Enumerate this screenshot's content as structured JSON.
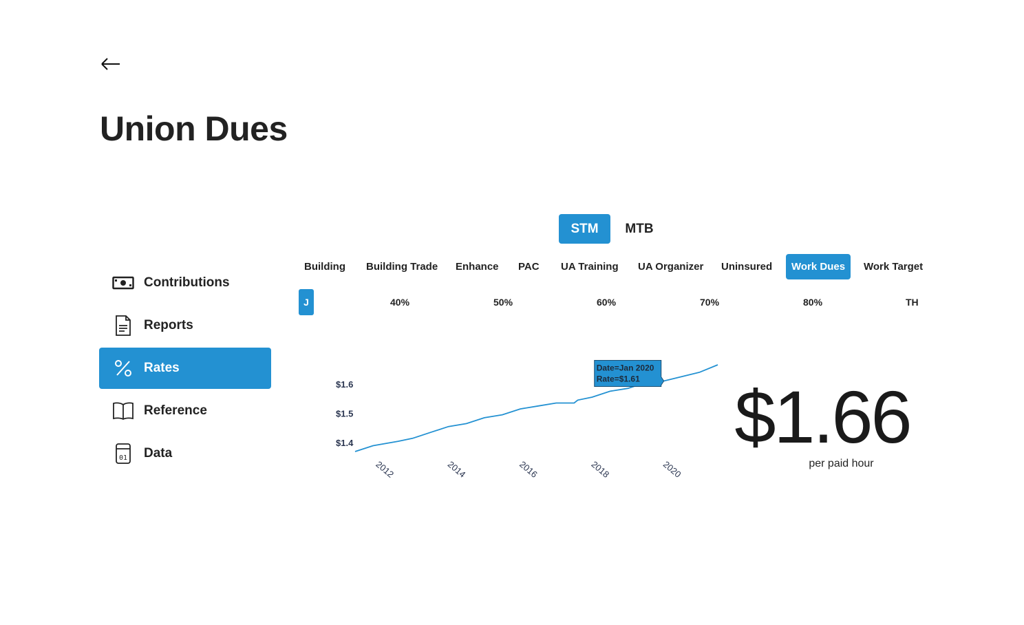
{
  "page": {
    "title": "Union Dues"
  },
  "nav": {
    "back_icon": "arrow-left-icon"
  },
  "sidebar": {
    "items": [
      {
        "label": "Contributions",
        "icon": "banknote-icon",
        "active": false
      },
      {
        "label": "Reports",
        "icon": "document-icon",
        "active": false
      },
      {
        "label": "Rates",
        "icon": "percent-icon",
        "active": true
      },
      {
        "label": "Reference",
        "icon": "book-icon",
        "active": false
      },
      {
        "label": "Data",
        "icon": "data-file-icon",
        "active": false
      }
    ]
  },
  "toggle": {
    "options": [
      "STM",
      "MTB"
    ],
    "selected": "STM"
  },
  "tabs": {
    "items": [
      "Building",
      "Building Trade",
      "Enhance",
      "PAC",
      "UA Training",
      "UA Organizer",
      "Uninsured",
      "Work Dues",
      "Work Target"
    ],
    "selected": "Work Dues"
  },
  "percent_row": {
    "items": [
      "J",
      "40%",
      "50%",
      "60%",
      "70%",
      "80%",
      "TH"
    ],
    "selected": "J"
  },
  "summary": {
    "rate": "$1.66",
    "unit": "per paid hour"
  },
  "colors": {
    "accent": "#2391d2",
    "line": "#2391d2"
  },
  "chart_data": {
    "type": "line",
    "x": [
      "2011.4",
      "2011.9",
      "2012.6",
      "2013.0",
      "2013.5",
      "2014.0",
      "2014.5",
      "2015.0",
      "2015.5",
      "2016.0",
      "2016.5",
      "2017.0",
      "2017.5",
      "2017.6",
      "2018.0",
      "2018.5",
      "2019.0",
      "2019.5",
      "2020.0",
      "2020.5",
      "2021.0",
      "2021.5"
    ],
    "values": [
      1.37,
      1.39,
      1.405,
      1.415,
      1.435,
      1.455,
      1.465,
      1.485,
      1.495,
      1.515,
      1.525,
      1.535,
      1.535,
      1.545,
      1.555,
      1.575,
      1.585,
      1.605,
      1.61,
      1.625,
      1.64,
      1.665
    ],
    "ylabels": [
      "$1.4",
      "$1.5",
      "$1.6"
    ],
    "yticks": [
      1.4,
      1.5,
      1.6
    ],
    "xlabels": [
      "2012",
      "2014",
      "2016",
      "2018",
      "2020"
    ],
    "xticks": [
      2012,
      2014,
      2016,
      2018,
      2020
    ],
    "xlim": [
      2011.4,
      2021.5
    ],
    "ylim": [
      1.37,
      1.665
    ],
    "tooltip": {
      "date": "Date=Jan 2020",
      "rate": "Rate=$1.61",
      "x": 2020.0,
      "y": 1.61
    }
  }
}
